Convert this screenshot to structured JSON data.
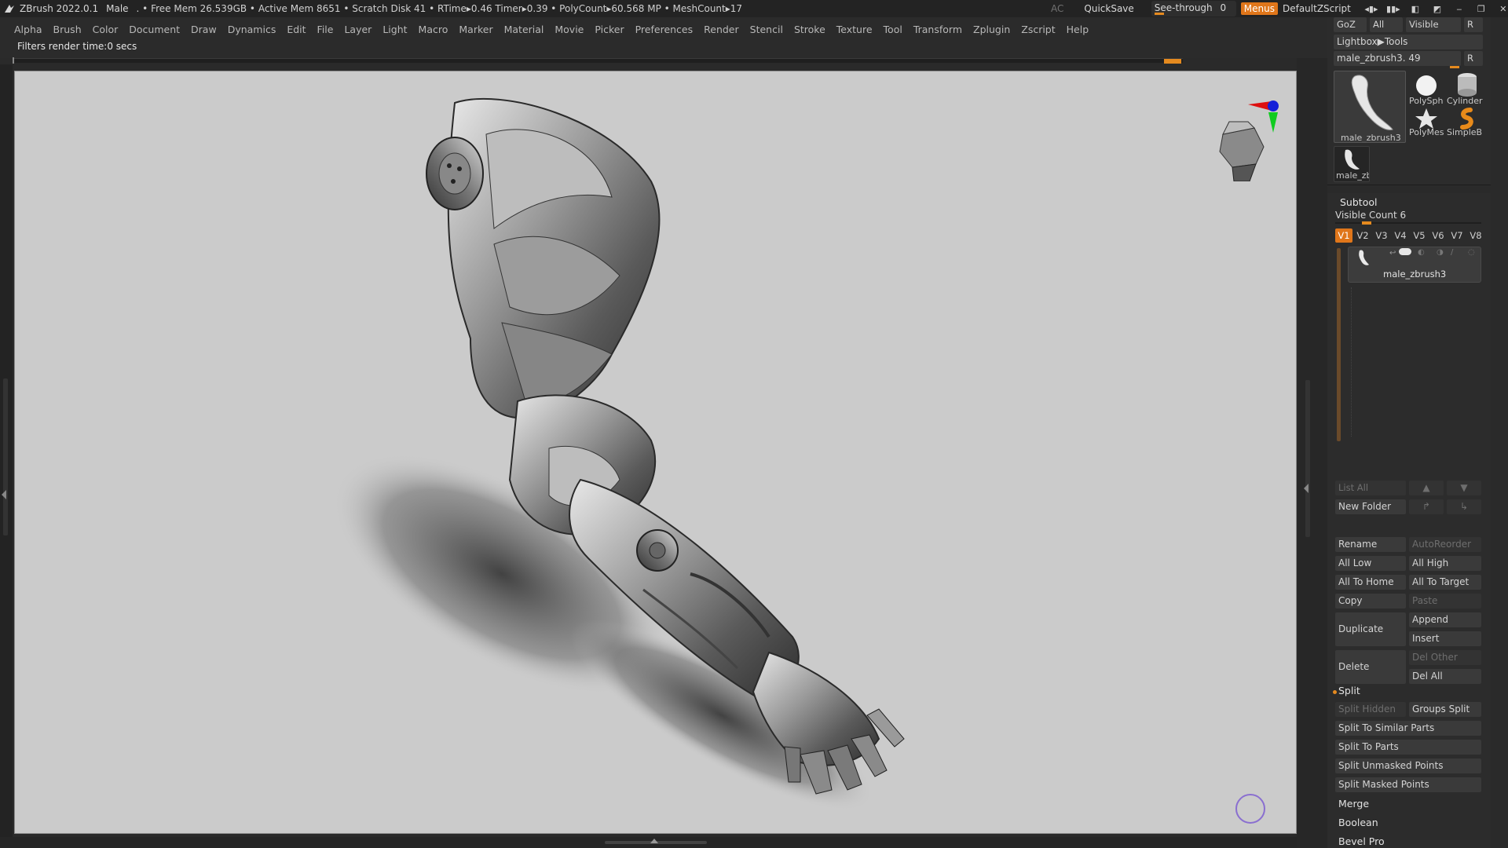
{
  "titlebar": {
    "app": "ZBrush 2022.0.1",
    "project": "Male",
    "stats": ". • Free Mem 26.539GB • Active Mem 8651 • Scratch Disk 41 • RTime▸0.46 Timer▸0.39 • PolyCount▸60.568 MP • MeshCount▸17",
    "ac": "AC",
    "quicksave": "QuickSave",
    "seethrough_label": "See-through",
    "seethrough_value": "0",
    "menus": "Menus",
    "script": "DefaultZScript"
  },
  "menubar": {
    "items": [
      "Alpha",
      "Brush",
      "Color",
      "Document",
      "Draw",
      "Dynamics",
      "Edit",
      "File",
      "Layer",
      "Light",
      "Macro",
      "Marker",
      "Material",
      "Movie",
      "Picker",
      "Preferences",
      "Render",
      "Stencil",
      "Stroke",
      "Texture",
      "Tool",
      "Transform",
      "Zplugin",
      "Zscript",
      "Help"
    ]
  },
  "infobar": {
    "message": "Filters render time:0 secs"
  },
  "tool": {
    "goz": "GoZ",
    "all": "All",
    "visible": "Visible",
    "r": "R",
    "lightbox": "Lightbox▶Tools",
    "current_tool": "male_zbrush3. 49",
    "thumbs": [
      {
        "label": "male_zbrush3",
        "icon": "arm-thumb-icon"
      },
      {
        "label": "PolySph",
        "icon": "sphere-icon"
      },
      {
        "label": "Cylinder",
        "icon": "cylinder-icon"
      },
      {
        "label": "PolyMes",
        "icon": "star-icon"
      },
      {
        "label": "SimpleB",
        "icon": "simplebrush-icon"
      },
      {
        "label": "male_zb",
        "icon": "arm-thumb-icon"
      }
    ]
  },
  "subtool": {
    "title": "Subtool",
    "visible_count_label": "Visible Count 6",
    "versions": [
      "V1",
      "V2",
      "V3",
      "V4",
      "V5",
      "V6",
      "V7",
      "V8"
    ],
    "active_version": "V1",
    "item_name": "male_zbrush3",
    "list_all": "List All",
    "new_folder": "New Folder",
    "rename": "Rename",
    "autoreorder": "AutoReorder",
    "all_low": "All Low",
    "all_high": "All High",
    "all_to_home": "All To Home",
    "all_to_target": "All To Target",
    "copy": "Copy",
    "paste": "Paste",
    "duplicate": "Duplicate",
    "append": "Append",
    "insert": "Insert",
    "delete": "Delete",
    "del_other": "Del Other",
    "del_all": "Del All",
    "split": "Split",
    "split_hidden": "Split Hidden",
    "groups_split": "Groups Split",
    "split_similar": "Split To Similar Parts",
    "split_parts": "Split To Parts",
    "split_unmasked": "Split Unmasked Points",
    "split_masked": "Split Masked Points",
    "merge": "Merge",
    "boolean": "Boolean",
    "bevel_pro": "Bevel Pro"
  },
  "colors": {
    "accent": "#e0761a",
    "canvas_bg": "#cbcbcb",
    "panel_bg": "#2c2c2c"
  }
}
